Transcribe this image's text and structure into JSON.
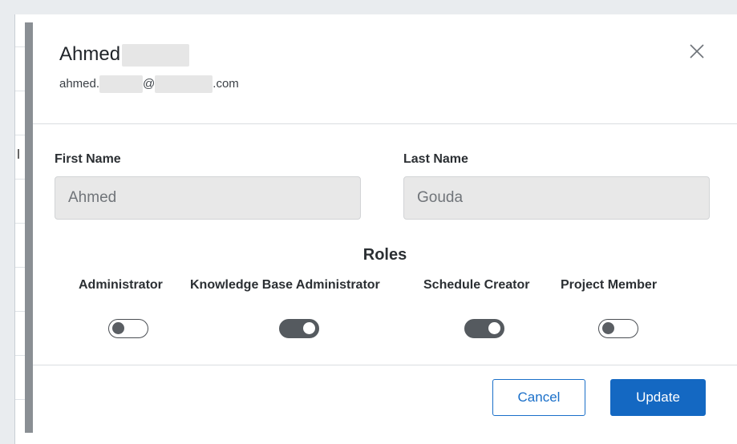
{
  "user": {
    "first_name_display": "Ahmed",
    "email_prefix": "ahmed.",
    "email_at": "@",
    "email_suffix": ".com"
  },
  "form": {
    "first_name_label": "First Name",
    "first_name_value": "Ahmed",
    "last_name_label": "Last Name",
    "last_name_value": "Gouda"
  },
  "roles": {
    "title": "Roles",
    "items": [
      {
        "label": "Administrator",
        "enabled": false
      },
      {
        "label": "Knowledge Base Administrator",
        "enabled": true
      },
      {
        "label": "Schedule Creator",
        "enabled": true
      },
      {
        "label": "Project Member",
        "enabled": false
      }
    ]
  },
  "footer": {
    "cancel_label": "Cancel",
    "update_label": "Update"
  },
  "colors": {
    "primary": "#1468c2",
    "toggle_on": "#555a5f",
    "input_bg": "#e8e8e8"
  },
  "icons": {
    "close": "close-icon"
  }
}
